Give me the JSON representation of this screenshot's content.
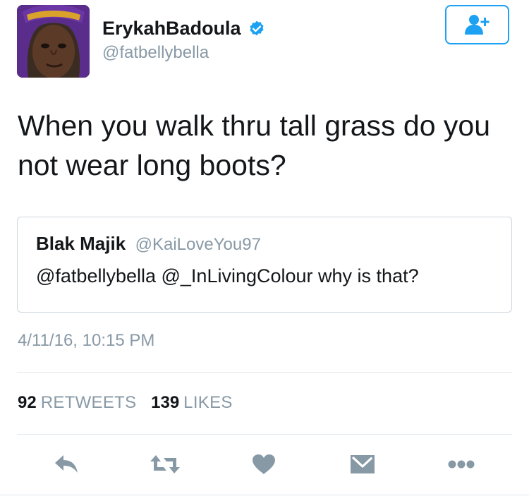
{
  "author": {
    "display_name": "ErykahBadoula",
    "handle": "@fatbellybella",
    "verified": true,
    "avatar_icon": "profile-photo"
  },
  "follow_button": {
    "icon": "add-user-icon",
    "color": "#1da1f2"
  },
  "tweet": {
    "text_line1": "When you walk thru tall grass do you",
    "text_line2": "not wear long boots?"
  },
  "quoted_tweet": {
    "name": "Blak Majik",
    "handle": "@KaiLoveYou97",
    "text": "@fatbellybella @_InLivingColour why is that?"
  },
  "timestamp": "4/11/16, 10:15 PM",
  "stats": {
    "retweets_count": "92",
    "retweets_label": "RETWEETS",
    "likes_count": "139",
    "likes_label": "LIKES"
  },
  "actions": [
    {
      "icon": "reply-icon"
    },
    {
      "icon": "retweet-icon"
    },
    {
      "icon": "like-heart-icon"
    },
    {
      "icon": "direct-message-icon"
    },
    {
      "icon": "more-options-icon"
    }
  ],
  "colors": {
    "text": "#14171a",
    "secondary": "#8899a6",
    "accent": "#1da1f2",
    "action_icon": "#8899a6"
  }
}
